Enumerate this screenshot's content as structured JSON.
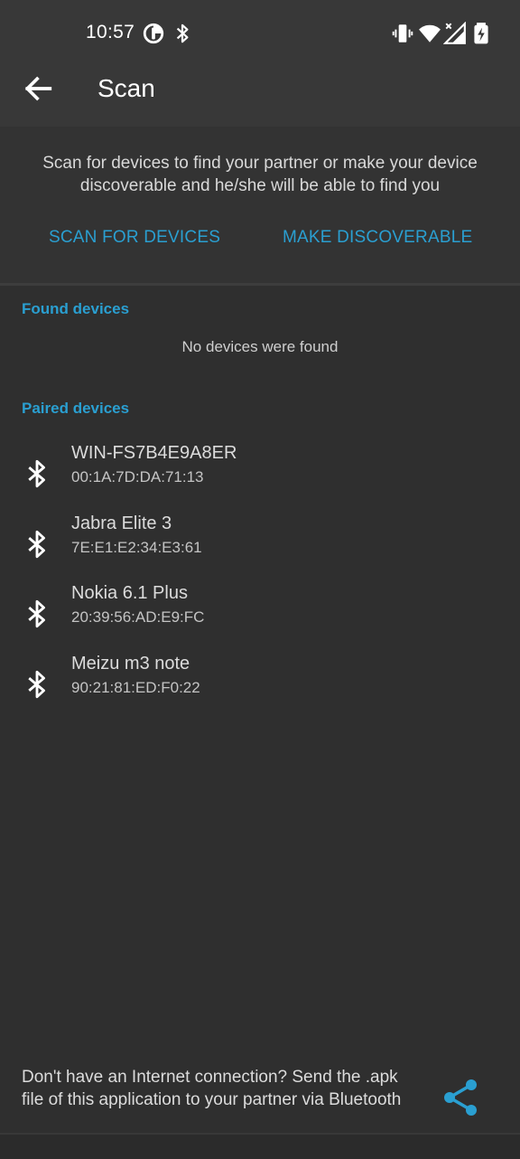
{
  "status_bar": {
    "time": "10:57",
    "icons": [
      "data-saver-icon",
      "bluetooth-icon",
      "vibrate-icon",
      "wifi-icon",
      "signal-icon",
      "battery-charging-icon"
    ]
  },
  "toolbar": {
    "back_icon": "arrow-back-icon",
    "title": "Scan"
  },
  "scan_header": {
    "description": "Scan for devices to find your partner or make your device discoverable and he/she will be able to find you",
    "scan_button": "SCAN FOR DEVICES",
    "discoverable_button": "MAKE DISCOVERABLE"
  },
  "found_devices": {
    "title": "Found devices",
    "empty_message": "No devices were found"
  },
  "paired_devices": {
    "title": "Paired devices",
    "items": [
      {
        "name": "WIN-FS7B4E9A8ER",
        "address": "00:1A:7D:DA:71:13",
        "icon": "bluetooth-icon"
      },
      {
        "name": "Jabra Elite 3",
        "address": "7E:E1:E2:34:E3:61",
        "icon": "bluetooth-icon"
      },
      {
        "name": "Nokia 6.1 Plus",
        "address": "20:39:56:AD:E9:FC",
        "icon": "bluetooth-icon"
      },
      {
        "name": "Meizu m3 note",
        "address": "90:21:81:ED:F0:22",
        "icon": "bluetooth-icon"
      }
    ]
  },
  "footer": {
    "message": "Don't have an Internet connection? Send the .apk file of this application to your partner via Bluetooth",
    "share_icon": "share-icon"
  },
  "colors": {
    "accent": "#2a9fd1",
    "background": "#2f2f2f",
    "appbar": "#383838"
  }
}
